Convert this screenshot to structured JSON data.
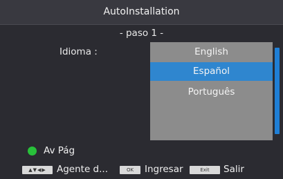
{
  "header": {
    "title": "AutoInstallation"
  },
  "wizard": {
    "step_label": "- paso 1 -",
    "field_label": "Idioma :",
    "languages": [
      {
        "label": "English",
        "selected": false
      },
      {
        "label": "Español",
        "selected": true
      },
      {
        "label": "Português",
        "selected": false
      }
    ]
  },
  "footer": {
    "green_label": "Av Pág",
    "nav_keys_glyphs": "▲▼◀▶",
    "nav_label": "Agente d...",
    "ok_key": "OK",
    "ok_label": "Ingresar",
    "exit_key": "Exit",
    "exit_label": "Salir"
  },
  "colors": {
    "background": "#2b2b31",
    "list_background": "#8c8c8c",
    "selected": "#2f86cf",
    "scrollbar": "#1f7fd6",
    "green_key": "#28c13a"
  }
}
